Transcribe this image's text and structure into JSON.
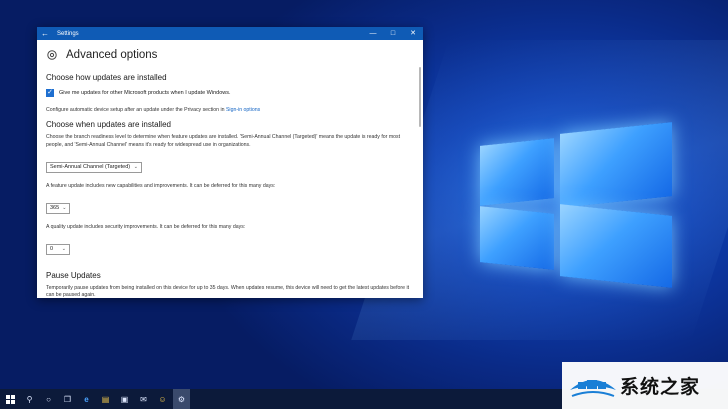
{
  "window": {
    "title": "Settings",
    "back_icon": "back-arrow-icon",
    "minimize_glyph": "—",
    "maximize_glyph": "□",
    "close_glyph": "✕"
  },
  "page": {
    "title": "Advanced options",
    "title_icon": "gear-icon"
  },
  "section_install": {
    "title": "Choose how updates are installed",
    "checkbox_label": "Give me updates for other Microsoft products when I update Windows.",
    "checkbox_checked": true,
    "privacy_text": "Configure automatic device setup after an update under the Privacy section in ",
    "privacy_link": "Sign-in options"
  },
  "section_when": {
    "title": "Choose when updates are installed",
    "description": "Choose the branch readiness level to determine when feature updates are installed. 'Semi-Annual Channel (Targeted)' means the update is ready for most people, and 'Semi-Annual Channel' means it's ready for widespread use in organizations.",
    "branch_value": "Semi-Annual Channel (Targeted)",
    "feature_text": "A feature update includes new capabilities and improvements. It can be deferred for this many days:",
    "feature_days": "365",
    "quality_text": "A quality update includes security improvements. It can be deferred for this many days:",
    "quality_days": "0"
  },
  "section_pause": {
    "title": "Pause Updates",
    "description": "Temporarily pause updates from being installed on this device for up to 35 days. When updates resume, this device will need to get the latest updates before it can be paused again."
  },
  "taskbar": {
    "icons": [
      "windows-start-icon",
      "search-icon",
      "cortana-icon",
      "task-view-icon",
      "edge-icon",
      "file-explorer-icon",
      "store-icon",
      "mail-icon",
      "people-icon",
      "settings-icon"
    ],
    "search_glyph": "⚲",
    "cortana_glyph": "○",
    "taskview_glyph": "❐",
    "edge_glyph": "e",
    "explorer_glyph": "▤",
    "store_glyph": "▣",
    "mail_glyph": "✉",
    "people_glyph": "☺",
    "settings_glyph": "⚙"
  },
  "watermark": {
    "text": "系统之家"
  },
  "colors": {
    "accent": "#0f5bb5",
    "checkbox": "#1e6fd0",
    "link": "#1364c4",
    "taskbar": "#0c1a3a",
    "desktop": "#0a2a86"
  }
}
